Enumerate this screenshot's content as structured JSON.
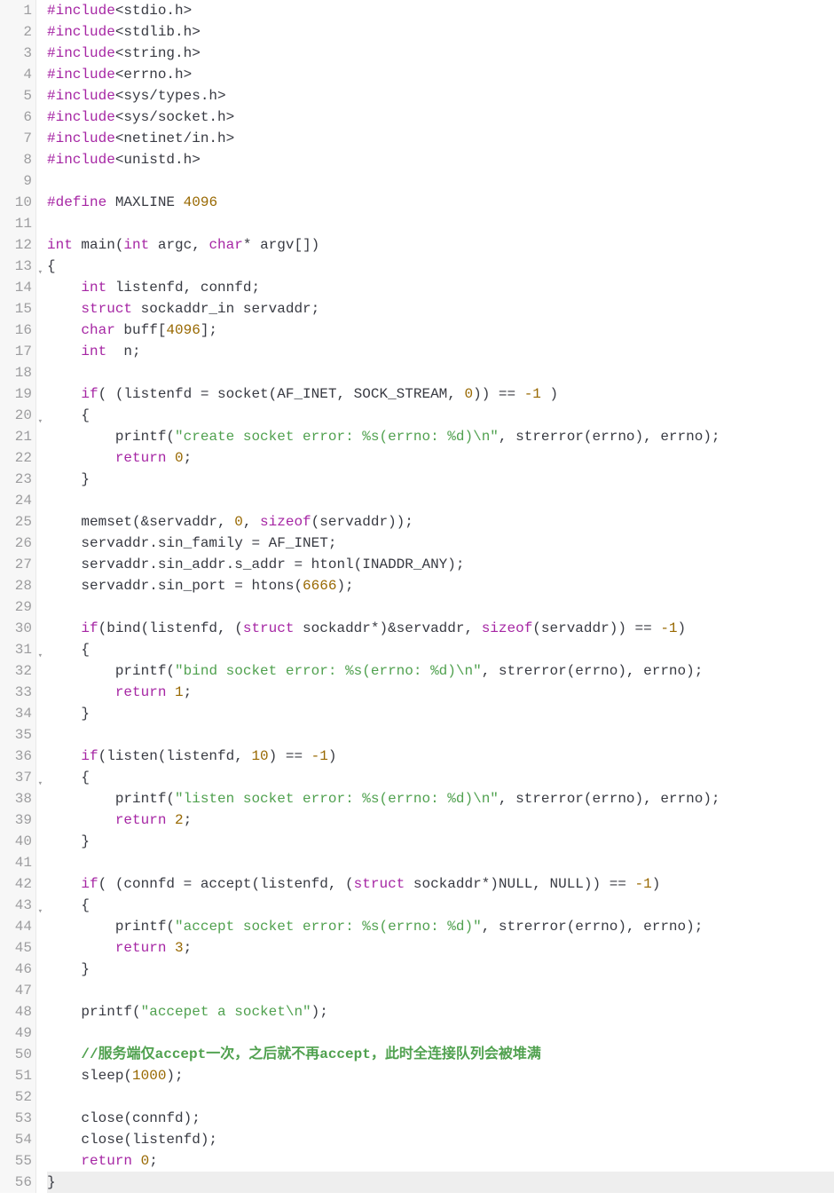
{
  "lines": [
    {
      "n": 1,
      "fold": false,
      "tokens": [
        {
          "c": "t-pre",
          "t": "#include"
        },
        {
          "c": "t-inc",
          "t": "<stdio.h>"
        }
      ]
    },
    {
      "n": 2,
      "fold": false,
      "tokens": [
        {
          "c": "t-pre",
          "t": "#include"
        },
        {
          "c": "t-inc",
          "t": "<stdlib.h>"
        }
      ]
    },
    {
      "n": 3,
      "fold": false,
      "tokens": [
        {
          "c": "t-pre",
          "t": "#include"
        },
        {
          "c": "t-inc",
          "t": "<string.h>"
        }
      ]
    },
    {
      "n": 4,
      "fold": false,
      "tokens": [
        {
          "c": "t-pre",
          "t": "#include"
        },
        {
          "c": "t-inc",
          "t": "<errno.h>"
        }
      ]
    },
    {
      "n": 5,
      "fold": false,
      "tokens": [
        {
          "c": "t-pre",
          "t": "#include"
        },
        {
          "c": "t-inc",
          "t": "<sys/types.h>"
        }
      ]
    },
    {
      "n": 6,
      "fold": false,
      "tokens": [
        {
          "c": "t-pre",
          "t": "#include"
        },
        {
          "c": "t-inc",
          "t": "<sys/socket.h>"
        }
      ]
    },
    {
      "n": 7,
      "fold": false,
      "tokens": [
        {
          "c": "t-pre",
          "t": "#include"
        },
        {
          "c": "t-inc",
          "t": "<netinet/in.h>"
        }
      ]
    },
    {
      "n": 8,
      "fold": false,
      "tokens": [
        {
          "c": "t-pre",
          "t": "#include"
        },
        {
          "c": "t-inc",
          "t": "<unistd.h>"
        }
      ]
    },
    {
      "n": 9,
      "fold": false,
      "tokens": []
    },
    {
      "n": 10,
      "fold": false,
      "tokens": [
        {
          "c": "t-pre",
          "t": "#define"
        },
        {
          "c": "t-id",
          "t": " MAXLINE "
        },
        {
          "c": "t-num",
          "t": "4096"
        }
      ]
    },
    {
      "n": 11,
      "fold": false,
      "tokens": []
    },
    {
      "n": 12,
      "fold": false,
      "tokens": [
        {
          "c": "t-kw",
          "t": "int"
        },
        {
          "c": "t-id",
          "t": " main("
        },
        {
          "c": "t-kw",
          "t": "int"
        },
        {
          "c": "t-id",
          "t": " argc, "
        },
        {
          "c": "t-kw",
          "t": "char"
        },
        {
          "c": "t-id",
          "t": "* argv[])"
        }
      ]
    },
    {
      "n": 13,
      "fold": true,
      "tokens": [
        {
          "c": "t-id",
          "t": "{"
        }
      ]
    },
    {
      "n": 14,
      "fold": false,
      "tokens": [
        {
          "c": "t-id",
          "t": "    "
        },
        {
          "c": "t-kw",
          "t": "int"
        },
        {
          "c": "t-id",
          "t": " listenfd, connfd;"
        }
      ]
    },
    {
      "n": 15,
      "fold": false,
      "tokens": [
        {
          "c": "t-id",
          "t": "    "
        },
        {
          "c": "t-kw",
          "t": "struct"
        },
        {
          "c": "t-id",
          "t": " sockaddr_in servaddr;"
        }
      ]
    },
    {
      "n": 16,
      "fold": false,
      "tokens": [
        {
          "c": "t-id",
          "t": "    "
        },
        {
          "c": "t-kw",
          "t": "char"
        },
        {
          "c": "t-id",
          "t": " buff["
        },
        {
          "c": "t-num",
          "t": "4096"
        },
        {
          "c": "t-id",
          "t": "];"
        }
      ]
    },
    {
      "n": 17,
      "fold": false,
      "tokens": [
        {
          "c": "t-id",
          "t": "    "
        },
        {
          "c": "t-kw",
          "t": "int"
        },
        {
          "c": "t-id",
          "t": "  n;"
        }
      ]
    },
    {
      "n": 18,
      "fold": false,
      "tokens": []
    },
    {
      "n": 19,
      "fold": false,
      "tokens": [
        {
          "c": "t-id",
          "t": "    "
        },
        {
          "c": "t-kw",
          "t": "if"
        },
        {
          "c": "t-id",
          "t": "( (listenfd = socket(AF_INET, SOCK_STREAM, "
        },
        {
          "c": "t-num",
          "t": "0"
        },
        {
          "c": "t-id",
          "t": ")) == "
        },
        {
          "c": "t-num",
          "t": "-1"
        },
        {
          "c": "t-id",
          "t": " )"
        }
      ]
    },
    {
      "n": 20,
      "fold": true,
      "tokens": [
        {
          "c": "t-id",
          "t": "    {"
        }
      ]
    },
    {
      "n": 21,
      "fold": false,
      "tokens": [
        {
          "c": "t-id",
          "t": "        printf("
        },
        {
          "c": "t-str",
          "t": "\"create socket error: %s(errno: %d)\\n\""
        },
        {
          "c": "t-id",
          "t": ", strerror(errno), errno);"
        }
      ]
    },
    {
      "n": 22,
      "fold": false,
      "tokens": [
        {
          "c": "t-id",
          "t": "        "
        },
        {
          "c": "t-kw",
          "t": "return"
        },
        {
          "c": "t-id",
          "t": " "
        },
        {
          "c": "t-num",
          "t": "0"
        },
        {
          "c": "t-id",
          "t": ";"
        }
      ]
    },
    {
      "n": 23,
      "fold": false,
      "tokens": [
        {
          "c": "t-id",
          "t": "    }"
        }
      ]
    },
    {
      "n": 24,
      "fold": false,
      "tokens": []
    },
    {
      "n": 25,
      "fold": false,
      "tokens": [
        {
          "c": "t-id",
          "t": "    memset(&servaddr, "
        },
        {
          "c": "t-num",
          "t": "0"
        },
        {
          "c": "t-id",
          "t": ", "
        },
        {
          "c": "t-kw",
          "t": "sizeof"
        },
        {
          "c": "t-id",
          "t": "(servaddr));"
        }
      ]
    },
    {
      "n": 26,
      "fold": false,
      "tokens": [
        {
          "c": "t-id",
          "t": "    servaddr.sin_family = AF_INET;"
        }
      ]
    },
    {
      "n": 27,
      "fold": false,
      "tokens": [
        {
          "c": "t-id",
          "t": "    servaddr.sin_addr.s_addr = htonl(INADDR_ANY);"
        }
      ]
    },
    {
      "n": 28,
      "fold": false,
      "tokens": [
        {
          "c": "t-id",
          "t": "    servaddr.sin_port = htons("
        },
        {
          "c": "t-num",
          "t": "6666"
        },
        {
          "c": "t-id",
          "t": ");"
        }
      ]
    },
    {
      "n": 29,
      "fold": false,
      "tokens": []
    },
    {
      "n": 30,
      "fold": false,
      "tokens": [
        {
          "c": "t-id",
          "t": "    "
        },
        {
          "c": "t-kw",
          "t": "if"
        },
        {
          "c": "t-id",
          "t": "(bind(listenfd, ("
        },
        {
          "c": "t-kw",
          "t": "struct"
        },
        {
          "c": "t-id",
          "t": " sockaddr*)&servaddr, "
        },
        {
          "c": "t-kw",
          "t": "sizeof"
        },
        {
          "c": "t-id",
          "t": "(servaddr)) == "
        },
        {
          "c": "t-num",
          "t": "-1"
        },
        {
          "c": "t-id",
          "t": ")"
        }
      ]
    },
    {
      "n": 31,
      "fold": true,
      "tokens": [
        {
          "c": "t-id",
          "t": "    {"
        }
      ]
    },
    {
      "n": 32,
      "fold": false,
      "tokens": [
        {
          "c": "t-id",
          "t": "        printf("
        },
        {
          "c": "t-str",
          "t": "\"bind socket error: %s(errno: %d)\\n\""
        },
        {
          "c": "t-id",
          "t": ", strerror(errno), errno);"
        }
      ]
    },
    {
      "n": 33,
      "fold": false,
      "tokens": [
        {
          "c": "t-id",
          "t": "        "
        },
        {
          "c": "t-kw",
          "t": "return"
        },
        {
          "c": "t-id",
          "t": " "
        },
        {
          "c": "t-num",
          "t": "1"
        },
        {
          "c": "t-id",
          "t": ";"
        }
      ]
    },
    {
      "n": 34,
      "fold": false,
      "tokens": [
        {
          "c": "t-id",
          "t": "    }"
        }
      ]
    },
    {
      "n": 35,
      "fold": false,
      "tokens": []
    },
    {
      "n": 36,
      "fold": false,
      "tokens": [
        {
          "c": "t-id",
          "t": "    "
        },
        {
          "c": "t-kw",
          "t": "if"
        },
        {
          "c": "t-id",
          "t": "(listen(listenfd, "
        },
        {
          "c": "t-num",
          "t": "10"
        },
        {
          "c": "t-id",
          "t": ") == "
        },
        {
          "c": "t-num",
          "t": "-1"
        },
        {
          "c": "t-id",
          "t": ")"
        }
      ]
    },
    {
      "n": 37,
      "fold": true,
      "tokens": [
        {
          "c": "t-id",
          "t": "    {"
        }
      ]
    },
    {
      "n": 38,
      "fold": false,
      "tokens": [
        {
          "c": "t-id",
          "t": "        printf("
        },
        {
          "c": "t-str",
          "t": "\"listen socket error: %s(errno: %d)\\n\""
        },
        {
          "c": "t-id",
          "t": ", strerror(errno), errno);"
        }
      ]
    },
    {
      "n": 39,
      "fold": false,
      "tokens": [
        {
          "c": "t-id",
          "t": "        "
        },
        {
          "c": "t-kw",
          "t": "return"
        },
        {
          "c": "t-id",
          "t": " "
        },
        {
          "c": "t-num",
          "t": "2"
        },
        {
          "c": "t-id",
          "t": ";"
        }
      ]
    },
    {
      "n": 40,
      "fold": false,
      "tokens": [
        {
          "c": "t-id",
          "t": "    }"
        }
      ]
    },
    {
      "n": 41,
      "fold": false,
      "tokens": []
    },
    {
      "n": 42,
      "fold": false,
      "tokens": [
        {
          "c": "t-id",
          "t": "    "
        },
        {
          "c": "t-kw",
          "t": "if"
        },
        {
          "c": "t-id",
          "t": "( (connfd = accept(listenfd, ("
        },
        {
          "c": "t-kw",
          "t": "struct"
        },
        {
          "c": "t-id",
          "t": " sockaddr*)NULL, NULL)) == "
        },
        {
          "c": "t-num",
          "t": "-1"
        },
        {
          "c": "t-id",
          "t": ")"
        }
      ]
    },
    {
      "n": 43,
      "fold": true,
      "tokens": [
        {
          "c": "t-id",
          "t": "    {"
        }
      ]
    },
    {
      "n": 44,
      "fold": false,
      "tokens": [
        {
          "c": "t-id",
          "t": "        printf("
        },
        {
          "c": "t-str",
          "t": "\"accept socket error: %s(errno: %d)\""
        },
        {
          "c": "t-id",
          "t": ", strerror(errno), errno);"
        }
      ]
    },
    {
      "n": 45,
      "fold": false,
      "tokens": [
        {
          "c": "t-id",
          "t": "        "
        },
        {
          "c": "t-kw",
          "t": "return"
        },
        {
          "c": "t-id",
          "t": " "
        },
        {
          "c": "t-num",
          "t": "3"
        },
        {
          "c": "t-id",
          "t": ";"
        }
      ]
    },
    {
      "n": 46,
      "fold": false,
      "tokens": [
        {
          "c": "t-id",
          "t": "    }"
        }
      ]
    },
    {
      "n": 47,
      "fold": false,
      "tokens": []
    },
    {
      "n": 48,
      "fold": false,
      "tokens": [
        {
          "c": "t-id",
          "t": "    printf("
        },
        {
          "c": "t-str",
          "t": "\"accepet a socket\\n\""
        },
        {
          "c": "t-id",
          "t": ");"
        }
      ]
    },
    {
      "n": 49,
      "fold": false,
      "tokens": []
    },
    {
      "n": 50,
      "fold": false,
      "tokens": [
        {
          "c": "t-id",
          "t": "    "
        },
        {
          "c": "t-com",
          "t": "//服务端仅accept一次，之后就不再accept，此时全连接队列会被堆满"
        }
      ]
    },
    {
      "n": 51,
      "fold": false,
      "tokens": [
        {
          "c": "t-id",
          "t": "    sleep("
        },
        {
          "c": "t-num",
          "t": "1000"
        },
        {
          "c": "t-id",
          "t": ");"
        }
      ]
    },
    {
      "n": 52,
      "fold": false,
      "tokens": []
    },
    {
      "n": 53,
      "fold": false,
      "tokens": [
        {
          "c": "t-id",
          "t": "    close(connfd);"
        }
      ]
    },
    {
      "n": 54,
      "fold": false,
      "tokens": [
        {
          "c": "t-id",
          "t": "    close(listenfd);"
        }
      ]
    },
    {
      "n": 55,
      "fold": false,
      "tokens": [
        {
          "c": "t-id",
          "t": "    "
        },
        {
          "c": "t-kw",
          "t": "return"
        },
        {
          "c": "t-id",
          "t": " "
        },
        {
          "c": "t-num",
          "t": "0"
        },
        {
          "c": "t-id",
          "t": ";"
        }
      ]
    },
    {
      "n": 56,
      "fold": false,
      "hl": true,
      "tokens": [
        {
          "c": "t-id",
          "t": "}"
        }
      ]
    }
  ],
  "fold_marker": "▾"
}
